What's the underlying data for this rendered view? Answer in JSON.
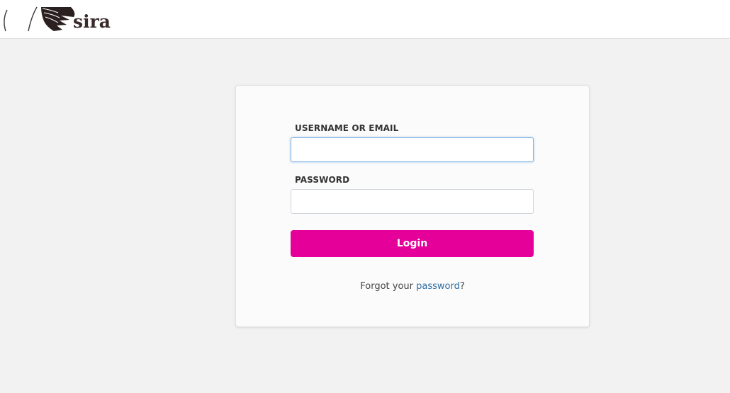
{
  "header": {
    "logo_text": "sira"
  },
  "login_form": {
    "username_label": "USERNAME OR EMAIL",
    "username_value": "",
    "password_label": "PASSWORD",
    "password_value": "",
    "login_button": "Login",
    "forgot_prefix": "Forgot your ",
    "forgot_link": "password",
    "forgot_suffix": "?"
  },
  "colors": {
    "page_background": "#f2f2f2",
    "accent_button": "#e6009a",
    "link": "#2d6ca2",
    "logo": "#3a2a2a"
  },
  "icons": {
    "logo": "feather-wing-logo-icon"
  }
}
